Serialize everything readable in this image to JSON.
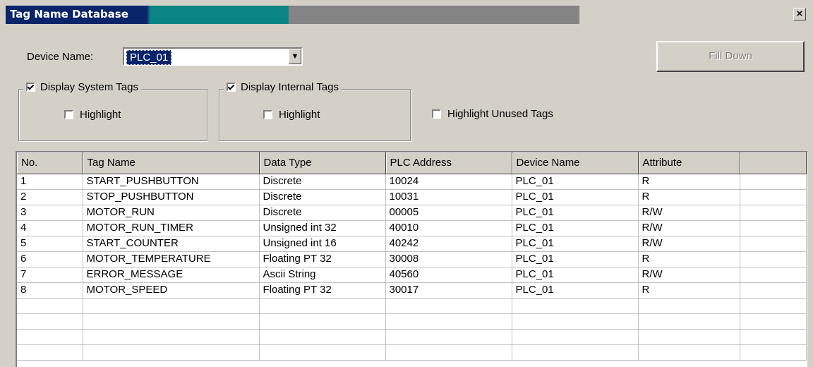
{
  "window": {
    "title": "Tag Name Database",
    "close_glyph": "×"
  },
  "device": {
    "label": "Device Name:",
    "selected": "PLC_01",
    "arrow_icon": "▼"
  },
  "fill_down_label": "Fill Down",
  "system_tags": {
    "label": "Display System Tags",
    "checked": true,
    "highlight_label": "Highlight",
    "highlight_checked": false
  },
  "internal_tags": {
    "label": "Display Internal Tags",
    "checked": true,
    "highlight_label": "Highlight",
    "highlight_checked": false
  },
  "highlight_unused_label": "Highlight Unused Tags",
  "table": {
    "headers": [
      "No.",
      "Tag Name",
      "Data Type",
      "PLC Address",
      "Device Name",
      "Attribute",
      ""
    ],
    "rows": [
      [
        "1",
        "START_PUSHBUTTON",
        "Discrete",
        "10024",
        "PLC_01",
        "R"
      ],
      [
        "2",
        "STOP_PUSHBUTTON",
        "Discrete",
        "10031",
        "PLC_01",
        "R"
      ],
      [
        "3",
        "MOTOR_RUN",
        "Discrete",
        "00005",
        "PLC_01",
        "R/W"
      ],
      [
        "4",
        "MOTOR_RUN_TIMER",
        "Unsigned int 32",
        "40010",
        "PLC_01",
        "R/W"
      ],
      [
        "5",
        "START_COUNTER",
        "Unsigned int 16",
        "40242",
        "PLC_01",
        "R/W"
      ],
      [
        "6",
        "MOTOR_TEMPERATURE",
        "Floating PT 32",
        "30008",
        "PLC_01",
        "R"
      ],
      [
        "7",
        "ERROR_MESSAGE",
        "Ascii String",
        "40560",
        "PLC_01",
        "R/W"
      ],
      [
        "8",
        "MOTOR_SPEED",
        "Floating PT 32",
        "30017",
        "PLC_01",
        "R"
      ]
    ],
    "empty_rows": 4
  }
}
